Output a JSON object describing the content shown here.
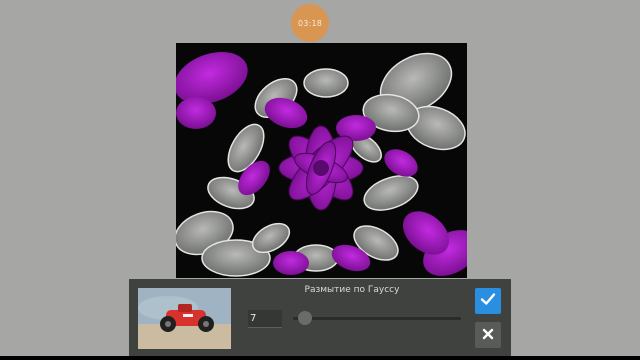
{
  "timer": {
    "label": "03:18"
  },
  "dialog": {
    "title": "Размытие по Гауссу",
    "radius_value": "7",
    "slider_fraction": 0.07,
    "confirm_icon": "check-icon",
    "cancel_icon": "close-icon"
  },
  "colors": {
    "background": "#a6a7a4",
    "accent": "#2a8fe0",
    "timer": "#d99552",
    "panel": "#40423f",
    "flower": "#a818c8"
  }
}
